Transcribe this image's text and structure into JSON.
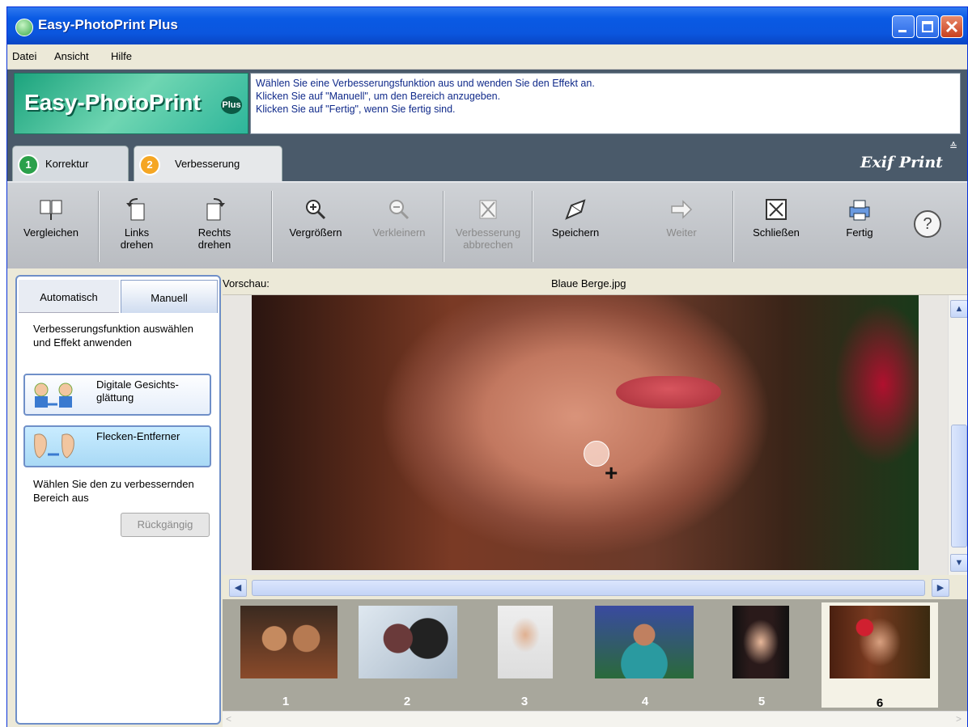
{
  "window": {
    "title": "Easy-PhotoPrint Plus"
  },
  "menu": [
    "Datei",
    "Ansicht",
    "Hilfe"
  ],
  "banner": {
    "logo": "Easy-PhotoPrint",
    "logo_badge": "Plus",
    "instructions": [
      "Wählen Sie eine Verbesserungsfunktion aus und wenden Sie den Effekt an.",
      "Klicken Sie auf \"Manuell\", um den Bereich anzugeben.",
      "Klicken Sie auf \"Fertig\", wenn Sie fertig sind."
    ]
  },
  "tabs": [
    {
      "num": "1",
      "label": "Korrektur"
    },
    {
      "num": "2",
      "label": "Verbesserung"
    }
  ],
  "brand": "Exif Print",
  "toolbar": {
    "compare": "Vergleichen",
    "rotate_left": [
      "Links",
      "drehen"
    ],
    "rotate_right": [
      "Rechts",
      "drehen"
    ],
    "zoom_in": "Vergrößern",
    "zoom_out": "Verkleinern",
    "cancel_enh": [
      "Verbesserung",
      "abbrechen"
    ],
    "save": "Speichern",
    "next": "Weiter",
    "close": "Schließen",
    "done": "Fertig",
    "help": "?"
  },
  "panel": {
    "tab_auto": "Automatisch",
    "tab_manual": "Manuell",
    "description": "Verbesserungsfunktion auswählen und Effekt anwenden",
    "functions": [
      {
        "label": "Digitale Gesichts-glättung"
      },
      {
        "label": "Flecken-Entferner"
      }
    ],
    "hint": "Wählen Sie den zu verbessernden Bereich aus",
    "undo": "Rückgängig"
  },
  "preview": {
    "label": "Vorschau:",
    "filename": "Blaue Berge.jpg"
  },
  "thumbnails": [
    "1",
    "2",
    "3",
    "4",
    "5",
    "6"
  ],
  "selected_thumbnail": "6",
  "colors": {
    "title_bar": "#0a5ae4",
    "accent_green": "#1ba37d",
    "tab_orange": "#f5a623"
  }
}
